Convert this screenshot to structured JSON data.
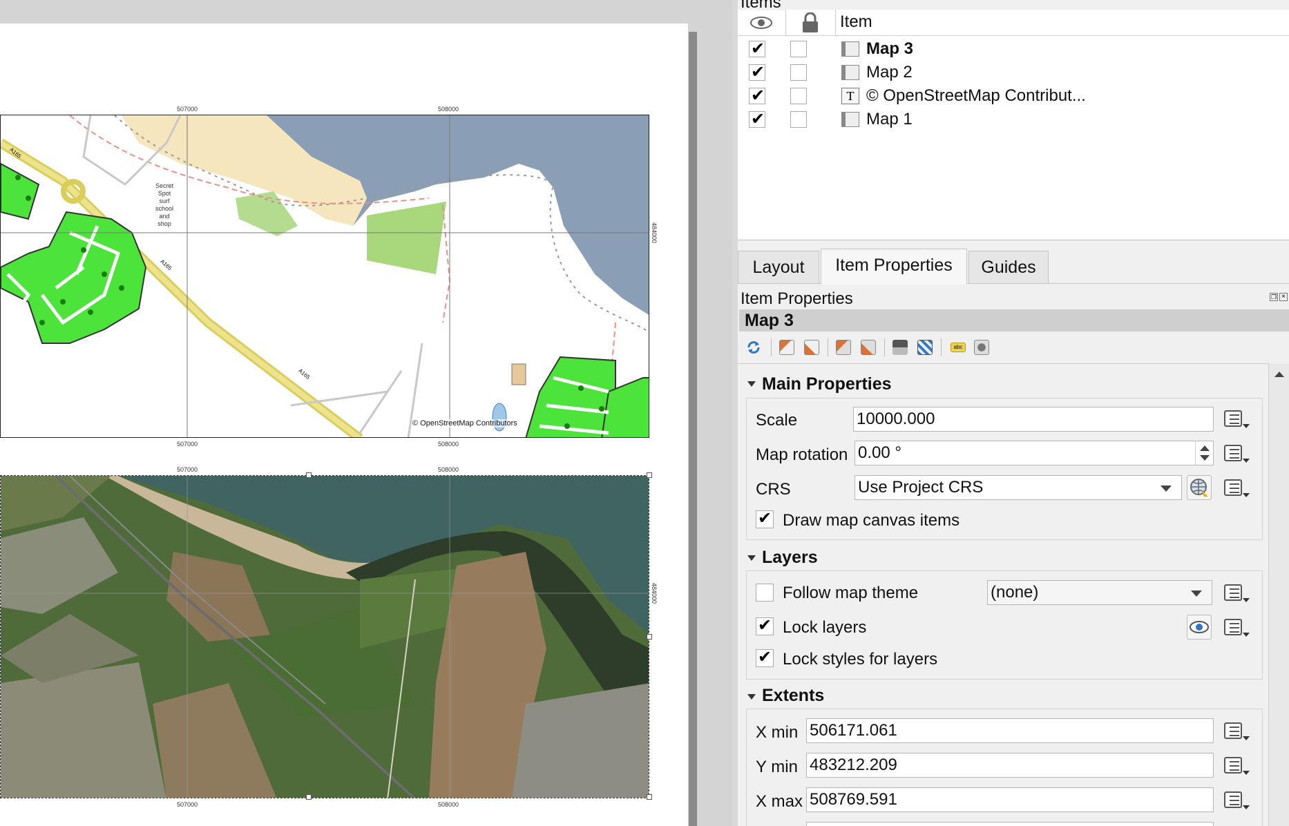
{
  "layout_canvas": {
    "map_labels": {
      "map1_top_x1": "507000",
      "map1_top_x2": "508000",
      "map1_bottom_x1": "507000",
      "map1_bottom_x2": "508000",
      "map1_right_y": "484000",
      "map2_top_x1": "507000",
      "map2_top_x2": "508000",
      "map2_bottom_x1": "507000",
      "map2_bottom_x2": "508000",
      "map2_right_y": "484000"
    },
    "map1_text": {
      "attribution": "© OpenStreetMap Contributors",
      "road_a165_1": "A165",
      "road_a165_2": "A165",
      "road_a165_3": "A165",
      "poi": [
        "Secret",
        "Spot",
        "surf",
        "school",
        "and",
        "shop"
      ]
    }
  },
  "items_panel": {
    "title": "Items",
    "header_item": "Item",
    "rows": [
      {
        "label": "Map 3",
        "visible": true,
        "locked": false,
        "icon": "map-item-icon",
        "bold": true
      },
      {
        "label": "Map 2",
        "visible": true,
        "locked": false,
        "icon": "map-item-icon",
        "bold": false
      },
      {
        "label": "© OpenStreetMap Contribut...",
        "visible": true,
        "locked": false,
        "icon": "text-item-icon",
        "bold": false
      },
      {
        "label": "Map 1",
        "visible": true,
        "locked": false,
        "icon": "map-item-icon",
        "bold": false
      }
    ]
  },
  "tabs": [
    "Layout",
    "Item Properties",
    "Guides"
  ],
  "active_tab": "Item Properties",
  "properties": {
    "dock_title": "Item Properties",
    "item_name": "Map 3",
    "main": {
      "title": "Main Properties",
      "scale_label": "Scale",
      "scale_value": "10000.000",
      "rotation_label": "Map rotation",
      "rotation_value": "0.00 °",
      "crs_label": "CRS",
      "crs_value": "Use Project CRS",
      "draw_canvas_label": "Draw map canvas items",
      "draw_canvas_checked": true
    },
    "layers": {
      "title": "Layers",
      "follow_theme_label": "Follow map theme",
      "follow_theme_checked": false,
      "theme_value": "(none)",
      "lock_layers_label": "Lock layers",
      "lock_layers_checked": true,
      "lock_styles_label": "Lock styles for layers",
      "lock_styles_checked": true
    },
    "extents": {
      "title": "Extents",
      "xmin_label": "X min",
      "xmin_value": "506171.061",
      "ymin_label": "Y min",
      "ymin_value": "483212.209",
      "xmax_label": "X max",
      "xmax_value": "508769.591"
    }
  },
  "colors": {
    "sea": "#8a9fb5",
    "sand": "#f6e6bd",
    "park": "#4ce43a",
    "road": "#d9cd5c",
    "accent": "#3077c8"
  }
}
